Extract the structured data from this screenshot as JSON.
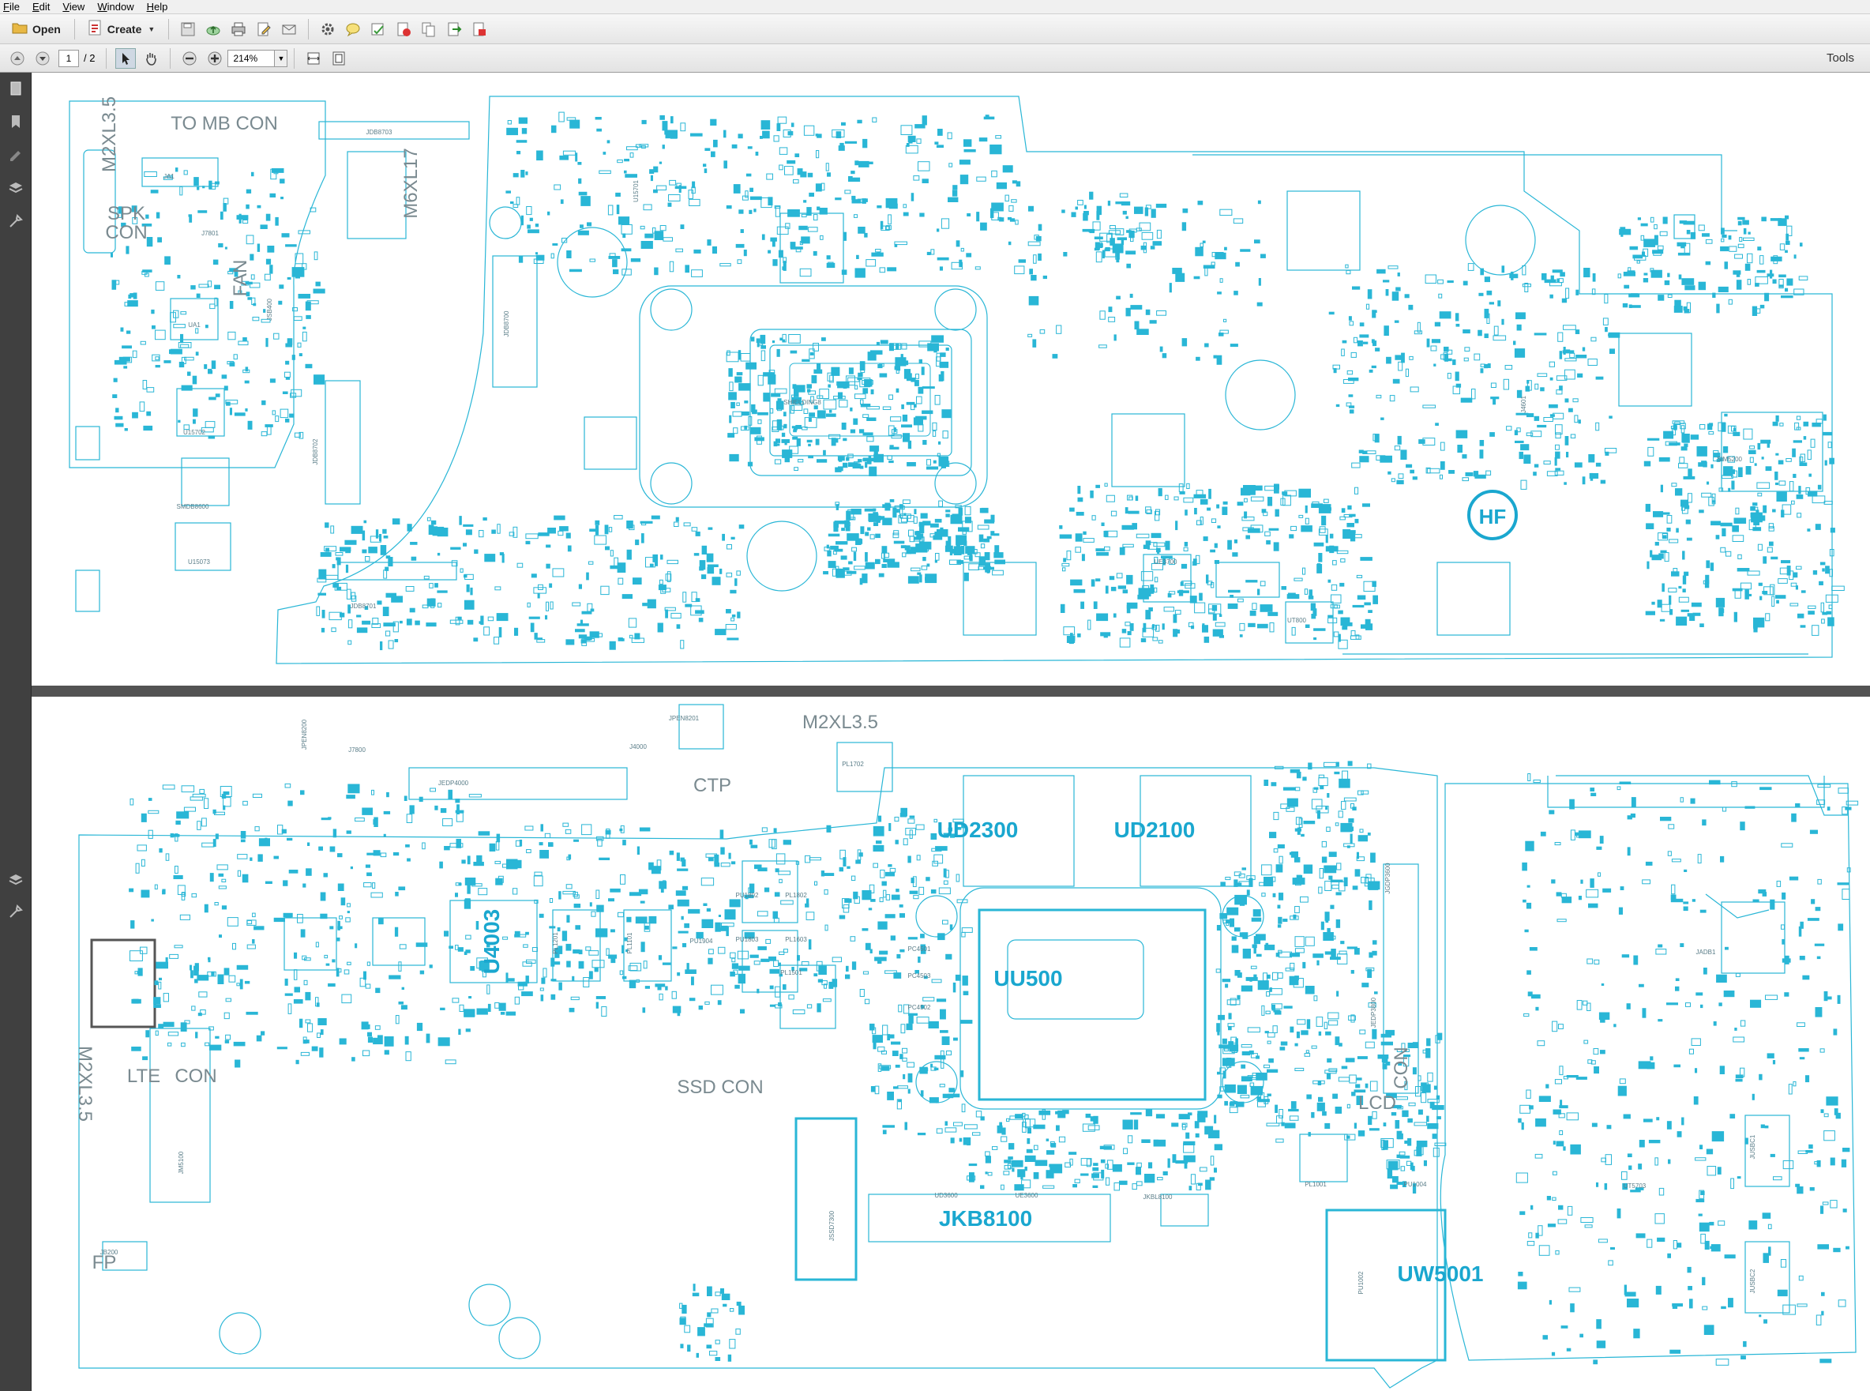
{
  "menu": [
    "File",
    "Edit",
    "View",
    "Window",
    "Help"
  ],
  "toolbar": {
    "open_label": "Open",
    "create_label": "Create",
    "page_current": "1",
    "page_total": "/ 2",
    "zoom": "214%",
    "tools_label": "Tools"
  },
  "colors": {
    "trace": "#29b6d6",
    "accent": "#1aa7cf"
  },
  "page1": {
    "labels": [
      {
        "t": "M2XL3.5",
        "cls": "big",
        "rot": -90
      },
      {
        "t": "TO MB CON",
        "cls": "big"
      },
      {
        "t": "JDB8703"
      },
      {
        "t": "M6XL17",
        "cls": "big",
        "rot": -90
      },
      {
        "t": "SPK",
        "cls": "big"
      },
      {
        "t": "CON",
        "cls": "big"
      },
      {
        "t": "JA1"
      },
      {
        "t": "J7801"
      },
      {
        "t": "FAN",
        "cls": "big",
        "rot": -90
      },
      {
        "t": "UA1"
      },
      {
        "t": "JSB400"
      },
      {
        "t": "U15702"
      },
      {
        "t": "JDB8702"
      },
      {
        "t": "SMDB8600"
      },
      {
        "t": "U15073"
      },
      {
        "t": "JDB8701"
      },
      {
        "t": "JDB8700"
      },
      {
        "t": "U15701"
      },
      {
        "t": "SHIELDING8"
      },
      {
        "t": "UE3700"
      },
      {
        "t": "UT800"
      },
      {
        "t": "HF",
        "cls": "logo"
      },
      {
        "t": "SIM5200"
      },
      {
        "t": "J4601"
      }
    ]
  },
  "page2": {
    "labels": [
      {
        "t": "JPEN8201"
      },
      {
        "t": "M2XL3.5",
        "cls": "big"
      },
      {
        "t": "PL1702"
      },
      {
        "t": "UD2300",
        "cls": "huge"
      },
      {
        "t": "UD2100",
        "cls": "huge"
      },
      {
        "t": "JGDP3600"
      },
      {
        "t": "JPEN8200"
      },
      {
        "t": "J7800"
      },
      {
        "t": "JEDP4000"
      },
      {
        "t": "J4000"
      },
      {
        "t": "CTP",
        "cls": "big"
      },
      {
        "t": "PU1802"
      },
      {
        "t": "PL1802"
      },
      {
        "t": "PU1803"
      },
      {
        "t": "PL1603"
      },
      {
        "t": "U4003",
        "cls": "huge",
        "rot": -90
      },
      {
        "t": "PL1201"
      },
      {
        "t": "PL1101"
      },
      {
        "t": "PU1904"
      },
      {
        "t": "PL1501"
      },
      {
        "t": "UU500",
        "cls": "huge"
      },
      {
        "t": "JEDP3800"
      },
      {
        "t": "LCD",
        "cls": "big"
      },
      {
        "t": "CON",
        "cls": "big",
        "rot": -90
      },
      {
        "t": "PL1001"
      },
      {
        "t": "PU1004"
      },
      {
        "t": "JADB1"
      },
      {
        "t": "JUSBC1"
      },
      {
        "t": "UT5703"
      },
      {
        "t": "JUSBC2"
      },
      {
        "t": "M2XL3.5",
        "cls": "big",
        "rot": 90
      },
      {
        "t": "LTE",
        "cls": "big"
      },
      {
        "t": "CON",
        "cls": "big"
      },
      {
        "t": "JM5100"
      },
      {
        "t": "JB200"
      },
      {
        "t": "FP",
        "cls": "big"
      },
      {
        "t": "SSD CON",
        "cls": "big"
      },
      {
        "t": "JSSD7300"
      },
      {
        "t": "UD3600"
      },
      {
        "t": "UE3600"
      },
      {
        "t": "JKBL8100"
      },
      {
        "t": "JKB8100",
        "cls": "huge"
      },
      {
        "t": "PU1002"
      },
      {
        "t": "UW5001",
        "cls": "huge"
      },
      {
        "t": "PC4501"
      },
      {
        "t": "PC4503"
      },
      {
        "t": "PC4502"
      }
    ]
  }
}
